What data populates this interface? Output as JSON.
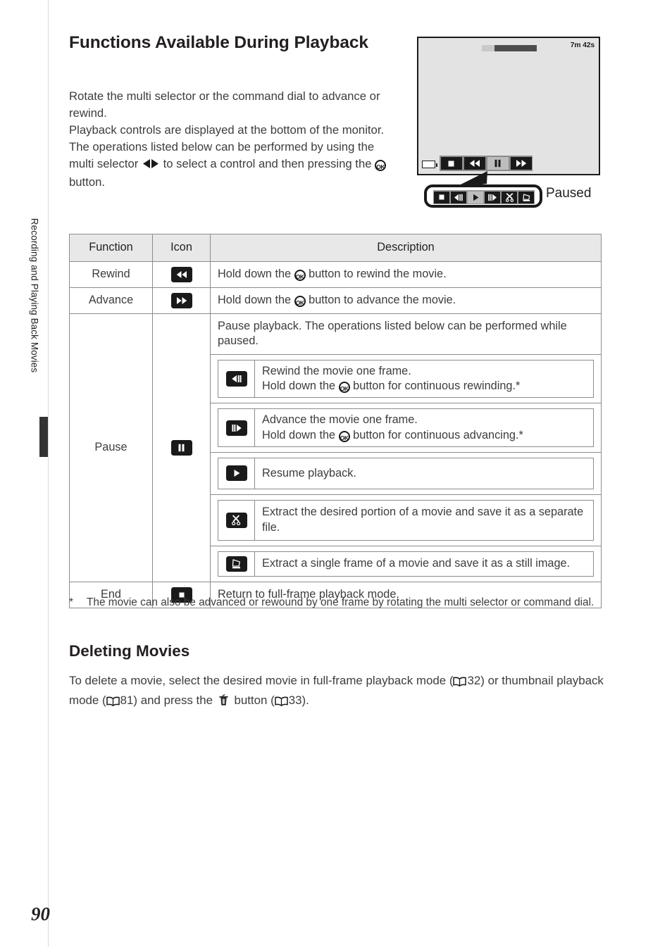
{
  "page": {
    "number": "90",
    "side_tab_label": "Recording and Playing Back Movies"
  },
  "section": {
    "title": "Functions Available During Playback",
    "paragraphs": [
      "Rotate the multi selector or the command dial to advance or rewind.",
      "Playback controls are displayed at the bottom of the monitor."
    ],
    "para3_a": "The operations listed below can be performed by using the multi selector ",
    "para3_b": " to select a control and then pressing the ",
    "para3_c": " button."
  },
  "illustration": {
    "time_remaining": "7m 42s",
    "progress_percent": 23,
    "battery_icon": "battery-icon",
    "monitor_controls": [
      {
        "name": "end-stop-icon",
        "selected": false
      },
      {
        "name": "rewind-icon",
        "selected": false
      },
      {
        "name": "pause-icon",
        "selected": true
      },
      {
        "name": "advance-icon",
        "selected": false
      }
    ],
    "callout_controls": [
      {
        "name": "end-stop-icon",
        "selected": false
      },
      {
        "name": "frame-rewind-icon",
        "selected": false
      },
      {
        "name": "resume-play-icon",
        "selected": true
      },
      {
        "name": "frame-advance-icon",
        "selected": false
      },
      {
        "name": "scissors-edit-icon",
        "selected": false
      },
      {
        "name": "extract-still-icon",
        "selected": false
      }
    ],
    "callout_label": "Paused"
  },
  "table": {
    "headers": [
      "Function",
      "Icon",
      "Description"
    ],
    "rows": [
      {
        "function": "Rewind",
        "icon": "rewind-icon",
        "desc_a": "Hold down the ",
        "desc_b": " button to rewind the movie."
      },
      {
        "function": "Advance",
        "icon": "advance-icon",
        "desc_a": "Hold down the ",
        "desc_b": " button to advance the movie."
      }
    ],
    "pause_row": {
      "function": "Pause",
      "icon": "pause-icon",
      "intro": "Pause playback. The operations listed below can be performed while paused.",
      "sub_rows": [
        {
          "icon": "frame-rewind-icon",
          "line1": "Rewind the movie one frame.",
          "line2_a": "Hold down the ",
          "line2_b": " button for continuous rewinding.*"
        },
        {
          "icon": "frame-advance-icon",
          "line1": "Advance the movie one frame.",
          "line2_a": "Hold down the ",
          "line2_b": " button for continuous advancing.*"
        },
        {
          "icon": "resume-play-icon",
          "line1": "Resume playback.",
          "line2_a": "",
          "line2_b": ""
        },
        {
          "icon": "scissors-edit-icon",
          "line1": "Extract the desired portion of a movie and save it as a separate file.",
          "line2_a": "",
          "line2_b": ""
        },
        {
          "icon": "extract-still-icon",
          "line1": "Extract a single frame of a movie and save it as a still image.",
          "line2_a": "",
          "line2_b": ""
        }
      ]
    },
    "end_row": {
      "function": "End",
      "icon": "end-stop-icon",
      "desc": "Return to full-frame playback mode."
    }
  },
  "footnote": {
    "marker": "*",
    "text": "The movie can also be advanced or rewound by one frame by rotating the multi selector or command dial."
  },
  "deleting": {
    "title": "Deleting Movies",
    "t1": "To delete a movie, select the desired movie in full-frame playback mode (",
    "ref1": "32",
    "t2": ") or thumbnail playback mode (",
    "ref2": "81",
    "t3": ") and press the ",
    "t4": " button (",
    "ref3": "33",
    "t5": ")."
  },
  "colors": {
    "ink": "#231f20",
    "body_text": "#3d3d3d",
    "rule": "#8c8c8c",
    "header_fill": "#e8e8e8",
    "screen_fill": "#e3e3e3",
    "icon_black": "#1a1a1a",
    "icon_selected": "#bdbdbd",
    "tab_dark": "#333333"
  }
}
